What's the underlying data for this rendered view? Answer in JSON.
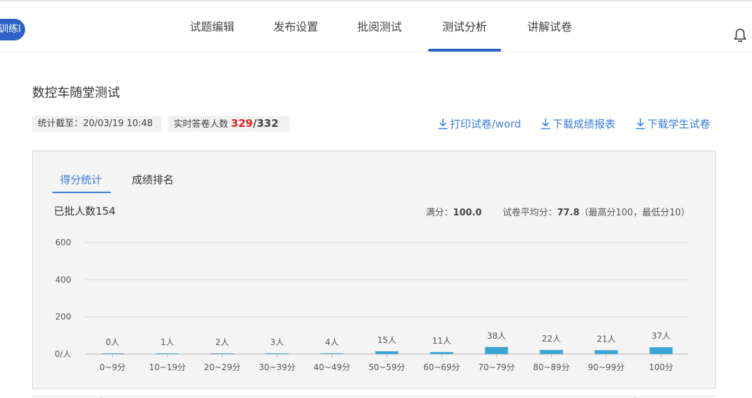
{
  "header": {
    "badge_label": "训练l",
    "tabs": [
      {
        "label": "试题编辑"
      },
      {
        "label": "发布设置"
      },
      {
        "label": "批阅测试"
      },
      {
        "label": "测试分析"
      },
      {
        "label": "讲解试卷"
      }
    ],
    "active_tab": 3,
    "bell_icon": "bell-icon"
  },
  "exam": {
    "title": "数控车随堂测试",
    "cutoff_label": "统计截至：",
    "cutoff_time": "20/03/19 10:48",
    "respondents_label": "实时答卷人数",
    "respondents_count": "329",
    "respondents_total": "/332"
  },
  "actions": {
    "print": "打印试卷/word",
    "download_report": "下载成绩报表",
    "download_papers": "下载学生试卷",
    "icon": "download-icon"
  },
  "panel": {
    "subtabs": [
      {
        "label": "得分统计"
      },
      {
        "label": "成绩排名"
      }
    ],
    "active_subtab": 0,
    "graded_label": "已批人数154",
    "full_score_label": "满分：",
    "full_score": "100.0",
    "avg_label": "试卷平均分：",
    "avg_score": "77.8",
    "range_note": "（最高分100，最低分10）"
  },
  "chart_data": {
    "type": "bar",
    "categories": [
      "0~9分",
      "10~19分",
      "20~29分",
      "30~39分",
      "40~49分",
      "50~59分",
      "60~69分",
      "70~79分",
      "80~89分",
      "90~99分",
      "100分"
    ],
    "values": [
      0,
      1,
      2,
      3,
      4,
      15,
      11,
      38,
      22,
      21,
      37
    ],
    "data_labels": [
      "0人",
      "1人",
      "2人",
      "3人",
      "4人",
      "15人",
      "11人",
      "38人",
      "22人",
      "21人",
      "37人"
    ],
    "y_ticks": [
      "0/人",
      "200",
      "400",
      "600"
    ],
    "ylim": [
      0,
      600
    ],
    "bar_color": "#3aa6d6",
    "grid": true
  },
  "colors": {
    "brand": "#2c62c6",
    "link": "#3a7bd5",
    "count": "#e02020"
  }
}
